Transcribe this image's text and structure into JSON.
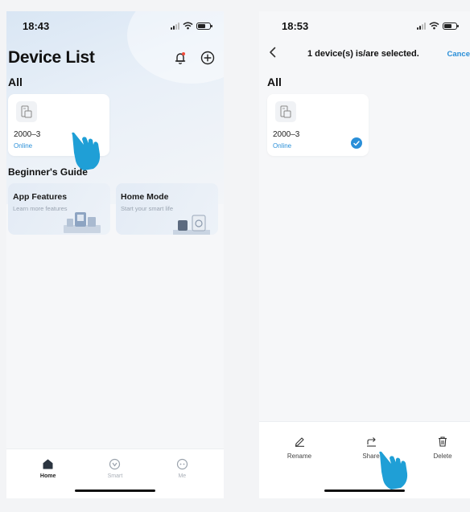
{
  "left": {
    "status": {
      "time": "18:43"
    },
    "header": {
      "title": "Device List"
    },
    "section_label": "All",
    "device": {
      "name": "2000–3",
      "status": "Online"
    },
    "guide": {
      "title": "Beginner's Guide",
      "cards": [
        {
          "title": "App Features",
          "subtitle": "Learn more features"
        },
        {
          "title": "Home Mode",
          "subtitle": "Start your smart life"
        }
      ]
    },
    "tabs": [
      {
        "label": "Home",
        "icon": "home-icon"
      },
      {
        "label": "Smart",
        "icon": "smart-icon"
      },
      {
        "label": "Me",
        "icon": "me-icon"
      }
    ]
  },
  "right": {
    "status": {
      "time": "18:53"
    },
    "selection_text": "1 device(s) is/are selected.",
    "cancel_label": "Cance",
    "section_label": "All",
    "device": {
      "name": "2000–3",
      "status": "Online"
    },
    "actions": [
      {
        "label": "Rename",
        "icon": "rename-icon"
      },
      {
        "label": "Share",
        "icon": "share-icon"
      },
      {
        "label": "Delete",
        "icon": "delete-icon"
      }
    ]
  },
  "colors": {
    "accent": "#2a8fd8",
    "pointer_hand": "#1f9fd6"
  }
}
